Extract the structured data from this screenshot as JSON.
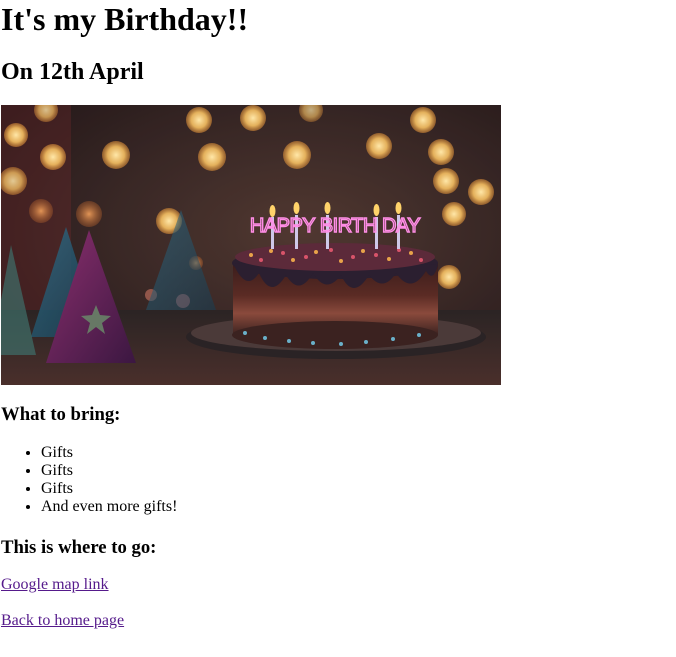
{
  "page": {
    "title": "It's my Birthday!!",
    "date_heading": "On 12th April"
  },
  "hero_image": {
    "alt": "Birthday cake with candles",
    "cake_text": "HAPPY BIRTH DAY"
  },
  "bring": {
    "heading": "What to bring:",
    "items": [
      "Gifts",
      "Gifts",
      "Gifts",
      "And even more gifts!"
    ]
  },
  "where": {
    "heading": "This is where to go:",
    "map_link": "Google map link"
  },
  "nav": {
    "home_link": "Back to home page"
  },
  "colors": {
    "visited_link": "#551a8b",
    "candle_neon": "#ff8de6"
  }
}
